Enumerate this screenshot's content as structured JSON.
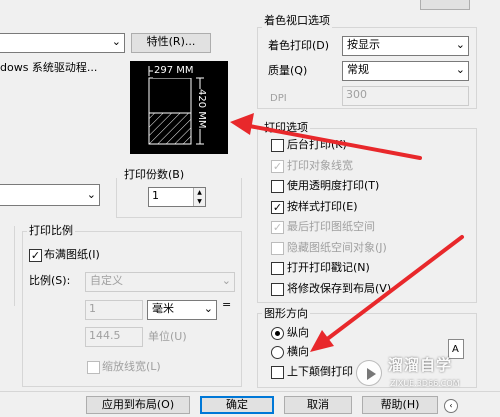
{
  "printer": {
    "properties_button": "特性(R)...",
    "driver_text": "dows 系统驱动程..."
  },
  "preview": {
    "width_label": "297 MM",
    "height_label": "420 MM"
  },
  "copies": {
    "label": "打印份数(B)",
    "value": "1"
  },
  "scale": {
    "group_title": "打印比例",
    "fit_label": "布满图纸(I)",
    "ratio_label": "比例(S):",
    "ratio_value": "自定义",
    "value1": "1",
    "unit_value": "毫米",
    "equals": "=",
    "value2": "144.5",
    "unit2_label": "单位(U)",
    "lineweights_label": "缩放线宽(L)"
  },
  "shaded": {
    "group_title": "着色视口选项",
    "shade_plot_label": "着色打印(D)",
    "shade_plot_value": "按显示",
    "quality_label": "质量(Q)",
    "quality_value": "常规",
    "dpi_label": "DPI",
    "dpi_value": "300"
  },
  "options": {
    "group_title": "打印选项",
    "items": [
      {
        "label": "后台打印(K)",
        "checked": false,
        "disabled": false
      },
      {
        "label": "打印对象线宽",
        "checked": true,
        "disabled": true
      },
      {
        "label": "使用透明度打印(T)",
        "checked": false,
        "disabled": false
      },
      {
        "label": "按样式打印(E)",
        "checked": true,
        "disabled": false
      },
      {
        "label": "最后打印图纸空间",
        "checked": true,
        "disabled": true
      },
      {
        "label": "隐藏图纸空间对象(J)",
        "checked": false,
        "disabled": true
      },
      {
        "label": "打开打印戳记(N)",
        "checked": false,
        "disabled": false
      },
      {
        "label": "将修改保存到布局(V)",
        "checked": false,
        "disabled": false
      }
    ]
  },
  "orientation": {
    "group_title": "图形方向",
    "portrait_label": "纵向",
    "landscape_label": "横向",
    "upside_down_label": "上下颠倒打印",
    "selected": "portrait"
  },
  "footer": {
    "apply_label": "应用到布局(O)",
    "ok_label": "确定",
    "cancel_label": "取消",
    "help_label": "帮助(H)"
  },
  "watermark": {
    "brand": "溜溜自学",
    "url": "ZIXUE.3D66.COM"
  },
  "colors": {
    "arrow": "#e8282b",
    "dialog_bg": "#f0f0f0",
    "focus_border": "#0078d7"
  }
}
